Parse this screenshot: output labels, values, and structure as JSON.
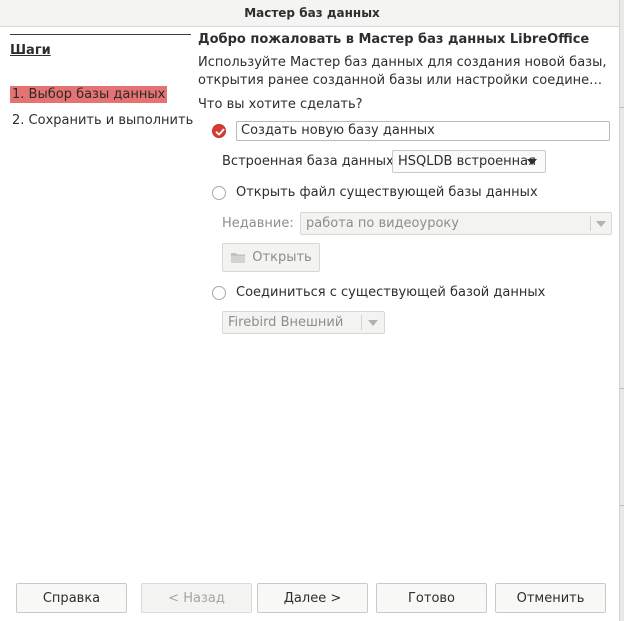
{
  "window": {
    "title": "Мастер баз данных"
  },
  "steps": {
    "title": "Шаги",
    "items": [
      {
        "label": "1. Выбор базы данных",
        "active": true
      },
      {
        "label": "2. Сохранить и выполнить",
        "active": false
      }
    ]
  },
  "main": {
    "heading": "Добро пожаловать в Мастер баз данных LibreOffice",
    "description_line1": "Используйте Мастер баз данных для создания новой базы,",
    "description_line2": "открытия ранее созданной базы или настройки соединения к се...",
    "question": "Что вы хотите сделать?",
    "create": {
      "label": "Создать новую базу данных",
      "selected": true,
      "embedded_label": "Встроенная база данных:",
      "embedded_value": "HSQLDB встроенная"
    },
    "open": {
      "label": "Открыть файл существующей базы данных",
      "selected": false,
      "recent_label": "Недавние:",
      "recent_value": "работа по видеоуроку",
      "open_button": "Открыть"
    },
    "connect": {
      "label": "Соединиться с существующей базой данных",
      "selected": false,
      "db_value": "Firebird Внешний"
    }
  },
  "buttons": {
    "help": "Справка",
    "back": "< Назад",
    "next": "Далее >",
    "finish": "Готово",
    "cancel": "Отменить"
  },
  "colors": {
    "accent": "#d83b32",
    "active_step_bg": "#e57373"
  },
  "icons": {
    "open_button_icon": "folder-icon",
    "selected_radio_icon": "checkmark-icon"
  }
}
